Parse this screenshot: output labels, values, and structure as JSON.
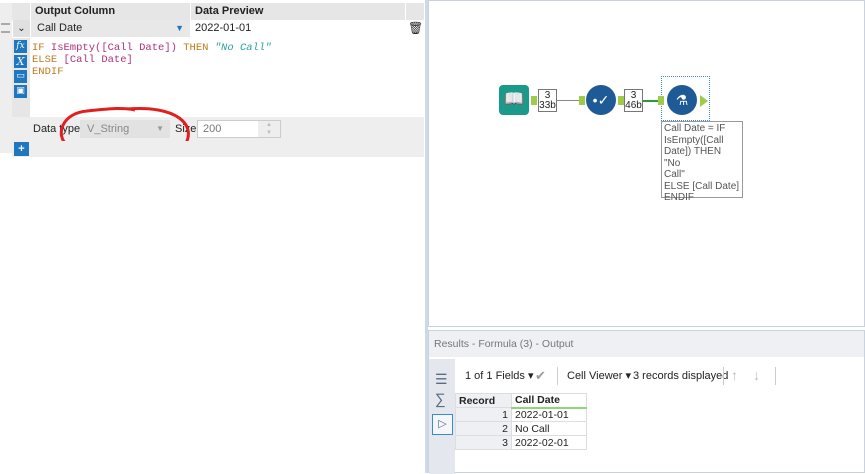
{
  "formula_panel": {
    "headers": {
      "output_column": "Output Column",
      "data_preview": "Data Preview"
    },
    "row": {
      "output_column": "Call Date",
      "data_preview": "2022-01-01"
    },
    "expression": {
      "line1": {
        "kw1": "IF ",
        "fn": "IsEmpty([Call Date])",
        "kw2": " THEN ",
        "str": "\"No Call\""
      },
      "line2": {
        "kw": "ELSE ",
        "field": "[Call Date]"
      },
      "line3": {
        "kw": "ENDIF"
      }
    },
    "data_type_label": "Data type:",
    "data_type_value": "V_String",
    "size_label": "Size:",
    "size_value": "200",
    "side_icons": [
      "fx-icon",
      "variable-icon",
      "open-icon",
      "save-icon"
    ]
  },
  "canvas": {
    "connection1": {
      "records": "3",
      "size": "33b"
    },
    "connection2": {
      "records": "3",
      "size": "46b"
    },
    "annotation": [
      "Call Date = IF",
      "IsEmpty([Call",
      "Date]) THEN \"No",
      "Call\"",
      "ELSE [Call Date]",
      "ENDIF"
    ]
  },
  "results": {
    "title": "Results - Formula (3) - Output",
    "fields": "1 of 1 Fields",
    "viewer": "Cell Viewer",
    "records_displayed": "3 records displayed",
    "columns": [
      "Record",
      "Call Date"
    ],
    "rows": [
      [
        "1",
        "2022-01-01"
      ],
      [
        "2",
        "No Call"
      ],
      [
        "3",
        "2022-02-01"
      ]
    ]
  },
  "colors": {
    "accent": "#1f77c0",
    "tool_teal": "#1a9a8a",
    "tool_blue": "#1e5a96",
    "anchor": "#9ccc4a",
    "annotation_red": "#e02020"
  }
}
